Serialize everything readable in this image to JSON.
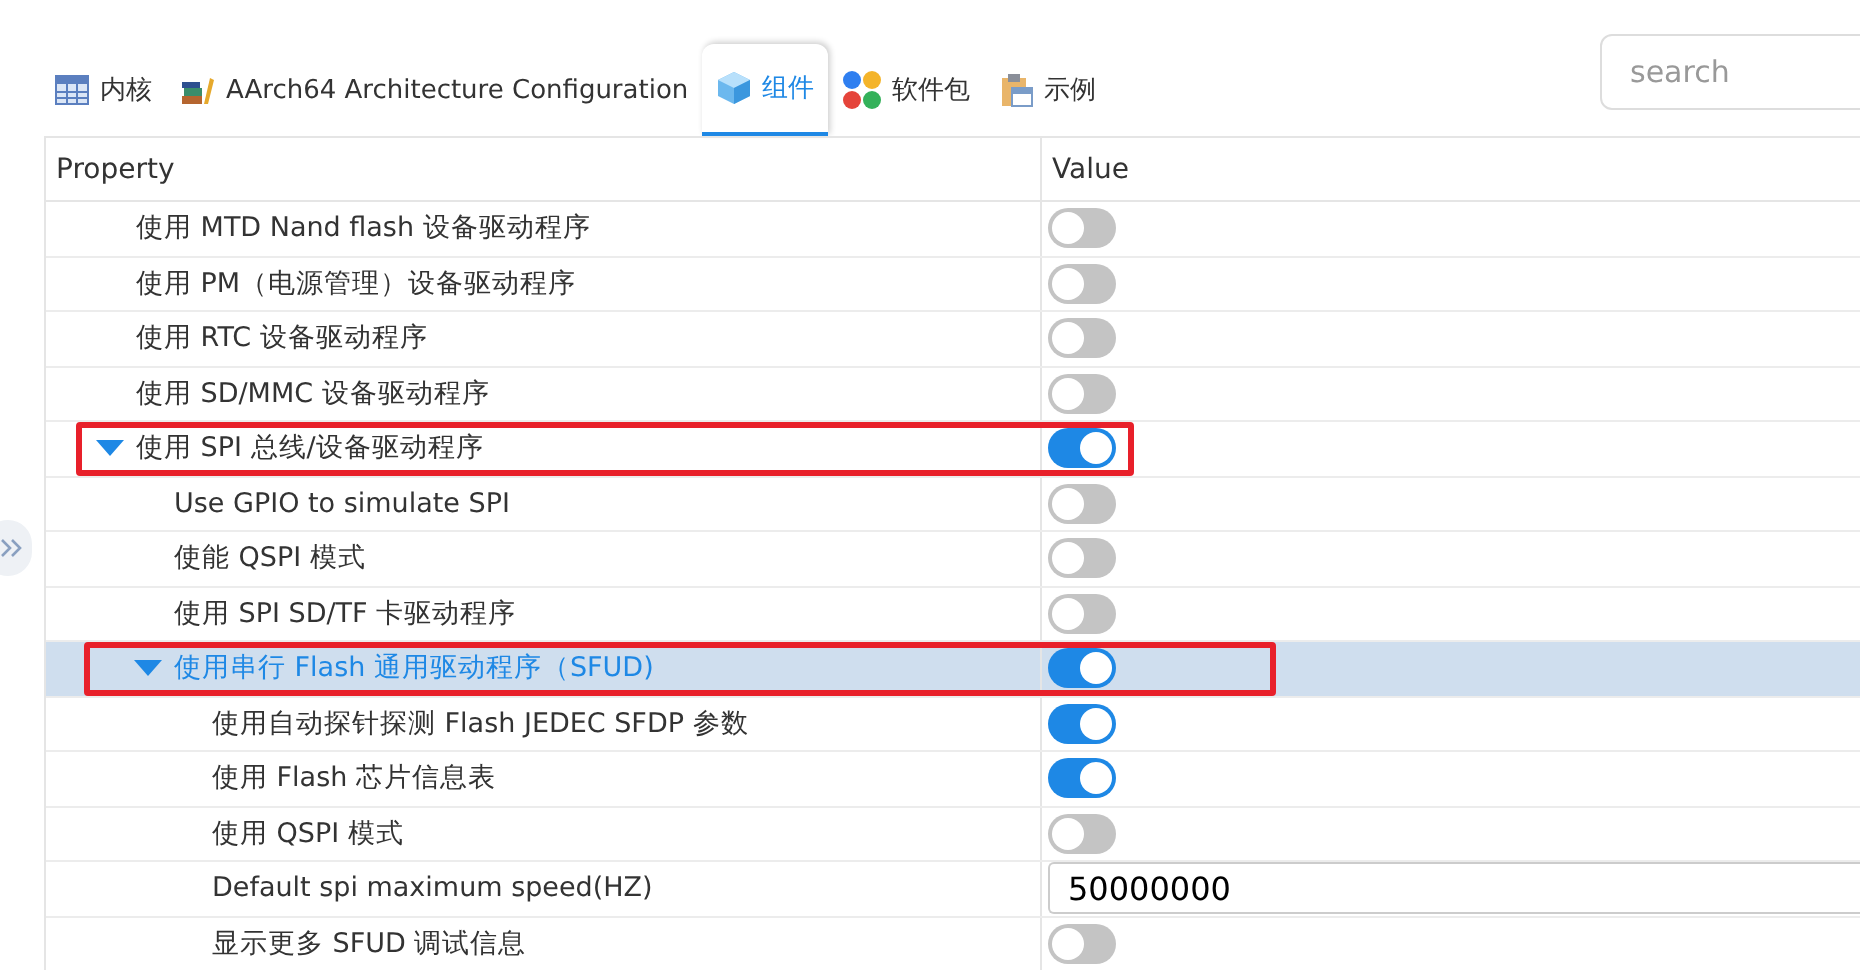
{
  "tabs": [
    {
      "label": "内核",
      "kind": "grid",
      "selected": false
    },
    {
      "label": "AArch64 Architecture Configuration",
      "kind": "books",
      "selected": false
    },
    {
      "label": "组件",
      "kind": "cube",
      "selected": true
    },
    {
      "label": "软件包",
      "kind": "dots",
      "selected": false
    },
    {
      "label": "示例",
      "kind": "clipboard",
      "selected": false
    }
  ],
  "search": {
    "placeholder": "search"
  },
  "table": {
    "columns": [
      "Property",
      "Value"
    ],
    "rows": [
      {
        "label": "使用 MTD Nand flash 设备驱动程序",
        "kind": "toggle",
        "on": false,
        "selected": false,
        "highlighted": false
      },
      {
        "label": "使用 PM（电源管理）设备驱动程序",
        "kind": "toggle",
        "on": false,
        "selected": false,
        "highlighted": false
      },
      {
        "label": "使用 RTC 设备驱动程序",
        "kind": "toggle",
        "on": false,
        "selected": false,
        "highlighted": false
      },
      {
        "label": "使用 SD/MMC 设备驱动程序",
        "kind": "toggle",
        "on": false,
        "selected": false,
        "highlighted": false
      },
      {
        "label": "使用 SPI 总线/设备驱动程序",
        "kind": "toggle",
        "on": true,
        "selected": false,
        "highlighted": true,
        "expanded": true,
        "children": [
          {
            "label": "Use GPIO to simulate SPI",
            "kind": "toggle",
            "on": false,
            "selected": false,
            "highlighted": false
          },
          {
            "label": "使能 QSPI 模式",
            "kind": "toggle",
            "on": false,
            "selected": false,
            "highlighted": false
          },
          {
            "label": "使用 SPI SD/TF 卡驱动程序",
            "kind": "toggle",
            "on": false,
            "selected": false,
            "highlighted": false
          },
          {
            "label": "使用串行 Flash 通用驱动程序（SFUD)",
            "kind": "toggle",
            "on": true,
            "selected": true,
            "highlighted": true,
            "expanded": true,
            "children": [
              {
                "label": "使用自动探针探测 Flash JEDEC SFDP 参数",
                "kind": "toggle",
                "on": true,
                "selected": false,
                "highlighted": false
              },
              {
                "label": "使用 Flash 芯片信息表",
                "kind": "toggle",
                "on": true,
                "selected": false,
                "highlighted": false
              },
              {
                "label": "使用 QSPI 模式",
                "kind": "toggle",
                "on": false,
                "selected": false,
                "highlighted": false
              },
              {
                "label": "Default spi maximum speed(HZ)",
                "kind": "number",
                "value": "50000000",
                "selected": false,
                "highlighted": false
              },
              {
                "label": "显示更多 SFUD 调试信息",
                "kind": "toggle",
                "on": false,
                "selected": false,
                "highlighted": false
              }
            ]
          }
        ]
      }
    ]
  }
}
